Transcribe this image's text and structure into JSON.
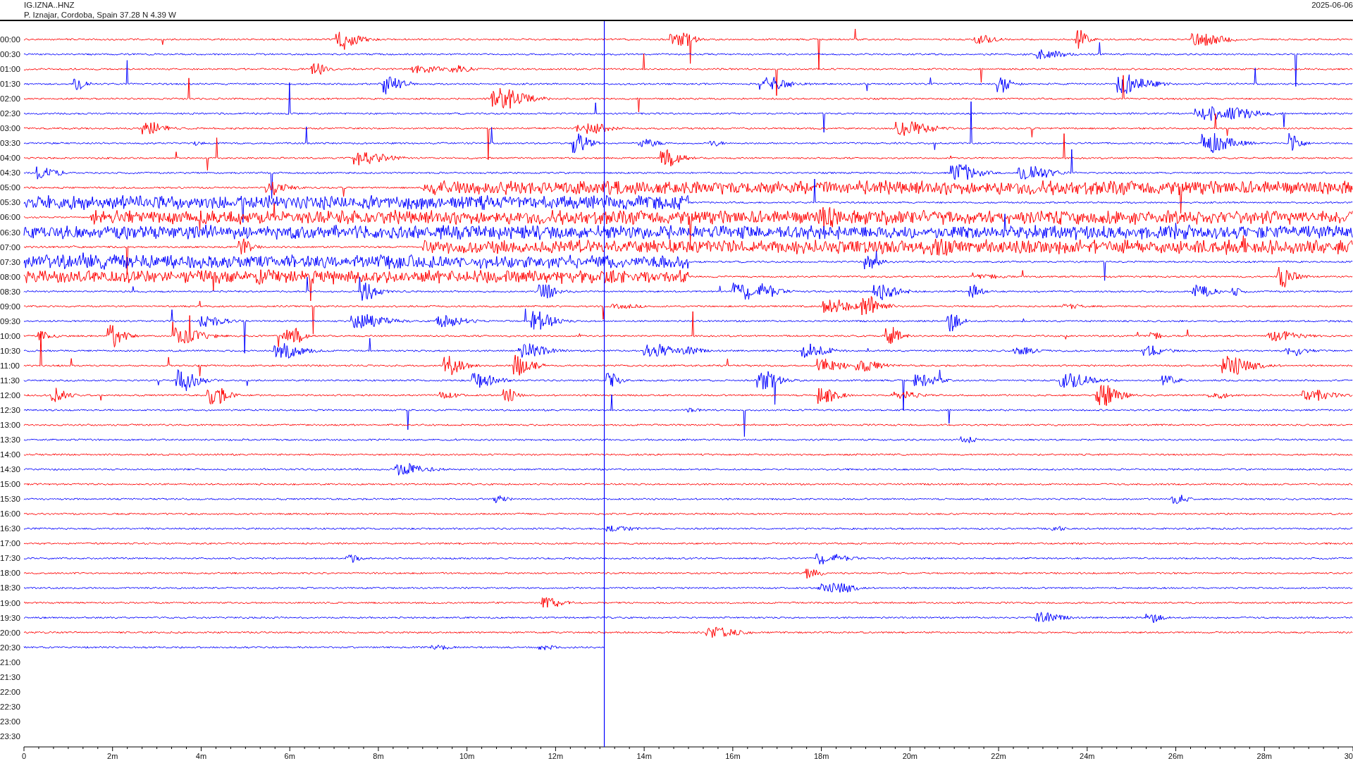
{
  "station": {
    "code": "IG.IZNA..HNZ",
    "location": "P. Iznajar, Cordoba, Spain  37.28 N 4.39 W",
    "date": "2025-06-06"
  },
  "helicorder": {
    "rows": [
      {
        "time": "00:00",
        "kind": "full",
        "color": "#ff0000"
      },
      {
        "time": "00:30",
        "kind": "full",
        "color": "#0000ff"
      },
      {
        "time": "01:00",
        "kind": "full",
        "color": "#ff0000"
      },
      {
        "time": "01:30",
        "kind": "full",
        "color": "#0000ff"
      },
      {
        "time": "02:00",
        "kind": "full",
        "color": "#ff0000"
      },
      {
        "time": "02:30",
        "kind": "full",
        "color": "#0000ff"
      },
      {
        "time": "03:00",
        "kind": "full",
        "color": "#ff0000"
      },
      {
        "time": "03:30",
        "kind": "full",
        "color": "#0000ff"
      },
      {
        "time": "04:00",
        "kind": "full",
        "color": "#ff0000"
      },
      {
        "time": "04:30",
        "kind": "full",
        "color": "#0000ff"
      },
      {
        "time": "05:00",
        "kind": "full",
        "color": "#ff0000"
      },
      {
        "time": "05:30",
        "kind": "full",
        "color": "#0000ff"
      },
      {
        "time": "06:00",
        "kind": "full",
        "color": "#ff0000"
      },
      {
        "time": "06:30",
        "kind": "full",
        "color": "#0000ff"
      },
      {
        "time": "07:00",
        "kind": "full",
        "color": "#ff0000"
      },
      {
        "time": "07:30",
        "kind": "full",
        "color": "#0000ff"
      },
      {
        "time": "08:00",
        "kind": "full",
        "color": "#ff0000"
      },
      {
        "time": "08:30",
        "kind": "full",
        "color": "#0000ff"
      },
      {
        "time": "09:00",
        "kind": "full",
        "color": "#ff0000"
      },
      {
        "time": "09:30",
        "kind": "full",
        "color": "#0000ff"
      },
      {
        "time": "10:00",
        "kind": "full",
        "color": "#ff0000"
      },
      {
        "time": "10:30",
        "kind": "full",
        "color": "#0000ff"
      },
      {
        "time": "11:00",
        "kind": "full",
        "color": "#ff0000"
      },
      {
        "time": "11:30",
        "kind": "full",
        "color": "#0000ff"
      },
      {
        "time": "12:00",
        "kind": "full",
        "color": "#ff0000"
      },
      {
        "time": "12:30",
        "kind": "full",
        "color": "#0000ff"
      },
      {
        "time": "13:00",
        "kind": "full",
        "color": "#ff0000"
      },
      {
        "time": "13:30",
        "kind": "full",
        "color": "#0000ff"
      },
      {
        "time": "14:00",
        "kind": "full",
        "color": "#ff0000"
      },
      {
        "time": "14:30",
        "kind": "full",
        "color": "#0000ff"
      },
      {
        "time": "15:00",
        "kind": "full",
        "color": "#ff0000"
      },
      {
        "time": "15:30",
        "kind": "full",
        "color": "#0000ff"
      },
      {
        "time": "16:00",
        "kind": "full",
        "color": "#ff0000"
      },
      {
        "time": "16:30",
        "kind": "full",
        "color": "#0000ff"
      },
      {
        "time": "17:00",
        "kind": "full",
        "color": "#ff0000"
      },
      {
        "time": "17:30",
        "kind": "full",
        "color": "#0000ff"
      },
      {
        "time": "18:00",
        "kind": "full",
        "color": "#ff0000"
      },
      {
        "time": "18:30",
        "kind": "full",
        "color": "#0000ff"
      },
      {
        "time": "19:00",
        "kind": "full",
        "color": "#ff0000"
      },
      {
        "time": "19:30",
        "kind": "full",
        "color": "#0000ff"
      },
      {
        "time": "20:00",
        "kind": "full",
        "color": "#ff0000"
      },
      {
        "time": "20:30",
        "kind": "partial",
        "color": "#0000ff"
      },
      {
        "time": "21:00",
        "kind": "empty"
      },
      {
        "time": "21:30",
        "kind": "empty"
      },
      {
        "time": "22:00",
        "kind": "empty"
      },
      {
        "time": "22:30",
        "kind": "empty"
      },
      {
        "time": "23:00",
        "kind": "empty"
      },
      {
        "time": "23:30",
        "kind": "empty"
      }
    ],
    "x_ticks": [
      "0",
      "2m",
      "4m",
      "6m",
      "8m",
      "10m",
      "12m",
      "14m",
      "16m",
      "18m",
      "20m",
      "22m",
      "24m",
      "26m",
      "28m",
      "30"
    ]
  }
}
